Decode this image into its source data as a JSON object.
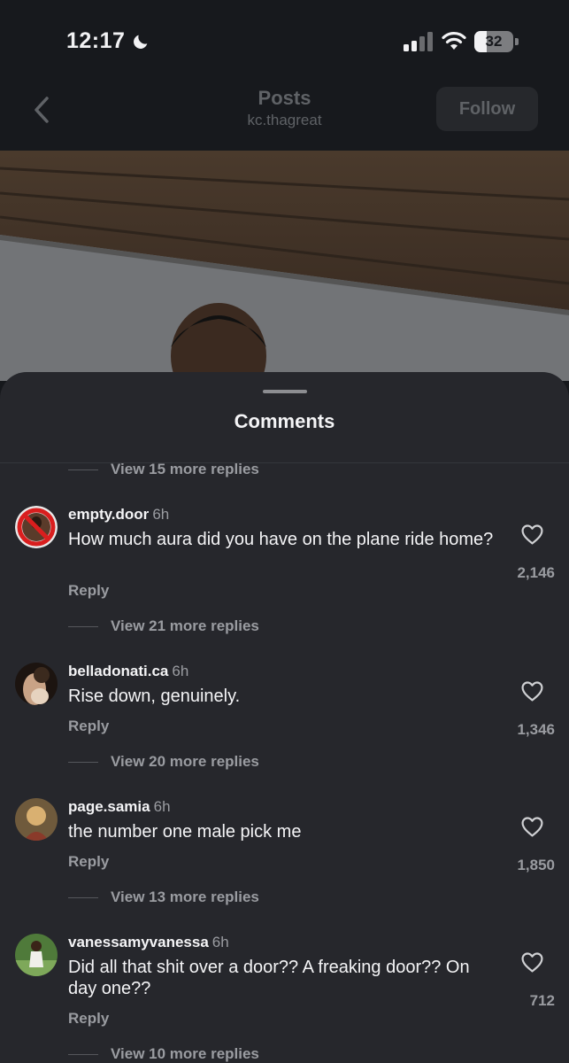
{
  "status_bar": {
    "time": "12:17",
    "battery_percent": 32,
    "battery_label": "32"
  },
  "nav": {
    "title": "Posts",
    "username": "kc.thagreat",
    "follow_label": "Follow"
  },
  "comments_sheet": {
    "title": "Comments",
    "top_view_replies": "View 15 more replies",
    "comments": [
      {
        "username": "empty.door",
        "time": "6h",
        "text": "How much aura did you have on the plane ride home?",
        "reply_label": "Reply",
        "likes": "2,146",
        "view_replies": "View 21 more replies"
      },
      {
        "username": "belladonati.ca",
        "time": "6h",
        "text": "Rise down, genuinely.",
        "reply_label": "Reply",
        "likes": "1,346",
        "view_replies": "View 20 more replies"
      },
      {
        "username": "page.samia",
        "time": "6h",
        "text": "the number one male pick me",
        "reply_label": "Reply",
        "likes": "1,850",
        "view_replies": "View 13 more replies"
      },
      {
        "username": "vanessamyvanessa",
        "time": "6h",
        "text": "Did all that shit over a door?? A freaking door?? On day one??",
        "reply_label": "Reply",
        "likes": "712",
        "view_replies": "View 10 more replies"
      }
    ]
  },
  "icons": {
    "back": "chevron-left-icon",
    "like": "heart-outline-icon",
    "signal": "cellular-signal-icon",
    "wifi": "wifi-icon",
    "do_not_disturb": "moon-icon"
  },
  "colors": {
    "background": "#16181c",
    "sheet": "#26272c",
    "text_primary": "#f4f4f6",
    "text_secondary": "#9a9ca1"
  }
}
